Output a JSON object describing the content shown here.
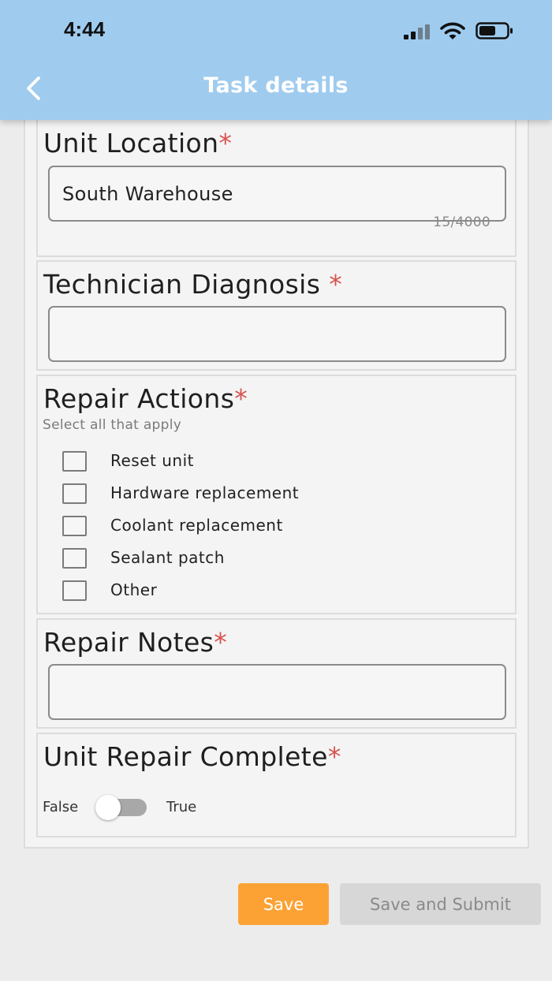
{
  "status_bar": {
    "time": "4:44",
    "icons": [
      "signal-icon",
      "wifi-icon",
      "battery-icon"
    ]
  },
  "header": {
    "title": "Task details",
    "back_icon": "chevron-left-icon",
    "background": "#9fcbee"
  },
  "form": {
    "unit_location": {
      "label": "Unit Location",
      "required_mark": "*",
      "value": "South Warehouse",
      "counter": "15/4000"
    },
    "technician_diagnosis": {
      "label": "Technician Diagnosis ",
      "required_mark": "*",
      "value": ""
    },
    "repair_actions": {
      "label": "Repair Actions",
      "required_mark": "*",
      "hint": "Select all that apply",
      "options": [
        {
          "label": "Reset unit",
          "checked": false
        },
        {
          "label": "Hardware replacement",
          "checked": false
        },
        {
          "label": "Coolant replacement",
          "checked": false
        },
        {
          "label": "Sealant patch",
          "checked": false
        },
        {
          "label": "Other",
          "checked": false
        }
      ]
    },
    "repair_notes": {
      "label": "Repair Notes",
      "required_mark": "*",
      "value": ""
    },
    "unit_repair_complete": {
      "label": "Unit Repair Complete",
      "required_mark": "*",
      "false_label": "False",
      "true_label": "True",
      "value": false
    }
  },
  "actions": {
    "save_label": "Save",
    "submit_label": "Save and Submit",
    "save_color": "#fca235",
    "submit_color": "#d7d7d7"
  },
  "colors": {
    "required": "#d9534f",
    "page_background": "#ececec"
  }
}
